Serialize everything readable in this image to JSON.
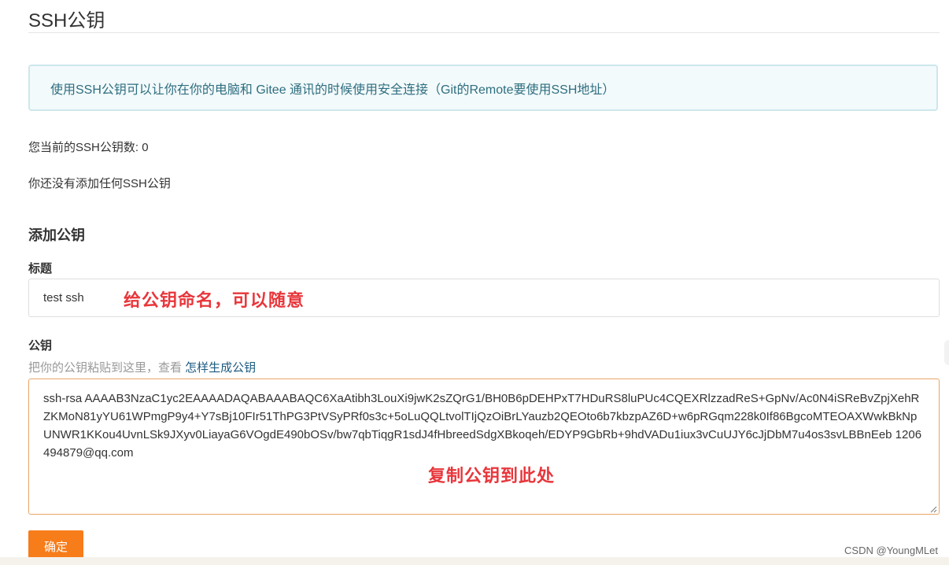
{
  "page": {
    "title": "SSH公钥"
  },
  "info": {
    "text": "使用SSH公钥可以让你在你的电脑和 Gitee 通讯的时候使用安全连接（Git的Remote要使用SSH地址）"
  },
  "status": {
    "count_label": "您当前的SSH公钥数: ",
    "count_value": "0",
    "empty_text": "你还没有添加任何SSH公钥"
  },
  "form": {
    "section_title": "添加公钥",
    "title_label": "标题",
    "title_value": "test ssh",
    "key_label": "公钥",
    "help_text": "把你的公钥粘贴到这里，查看 ",
    "help_link": "怎样生成公钥",
    "key_value": "ssh-rsa AAAAB3NzaC1yc2EAAAADAQABAAABAQC6XaAtibh3LouXi9jwK2sZQrG1/BH0B6pDEHPxT7HDuRS8luPUc4CQEXRlzzadReS+GpNv/Ac0N4iSReBvZpjXehRZKMoN81yYU61WPmgP9y4+Y7sBj10FIr51ThPG3PtVSyPRf0s3c+5oLuQQLtvolTIjQzOiBrLYauzb2QEOto6b7kbzpAZ6D+w6pRGqm228k0If86BgcoMTEOAXWwkBkNpUNWR1KKou4UvnLSk9JXyv0LiayaG6VOgdE490bOSv/bw7qbTiqgR1sdJ4fHbreedSdgXBkoqeh/EDYP9GbRb+9hdVADu1iux3vCuUJY6cJjDbM7u4os3svLBBnEeb 1206494879@qq.com",
    "submit_label": "确定"
  },
  "annotations": {
    "name_hint": "给公钥命名，可以随意",
    "copy_hint": "复制公钥到此处",
    "color": "#e8363b"
  },
  "watermark": {
    "text": "CSDN @YoungMLet"
  },
  "colors": {
    "accent": "#f77c1a",
    "info_bg": "#f3fafb",
    "info_border": "#cde7ec",
    "info_text": "#2e6e80",
    "link": "#1d5b80",
    "focus_border": "#e9a567"
  }
}
